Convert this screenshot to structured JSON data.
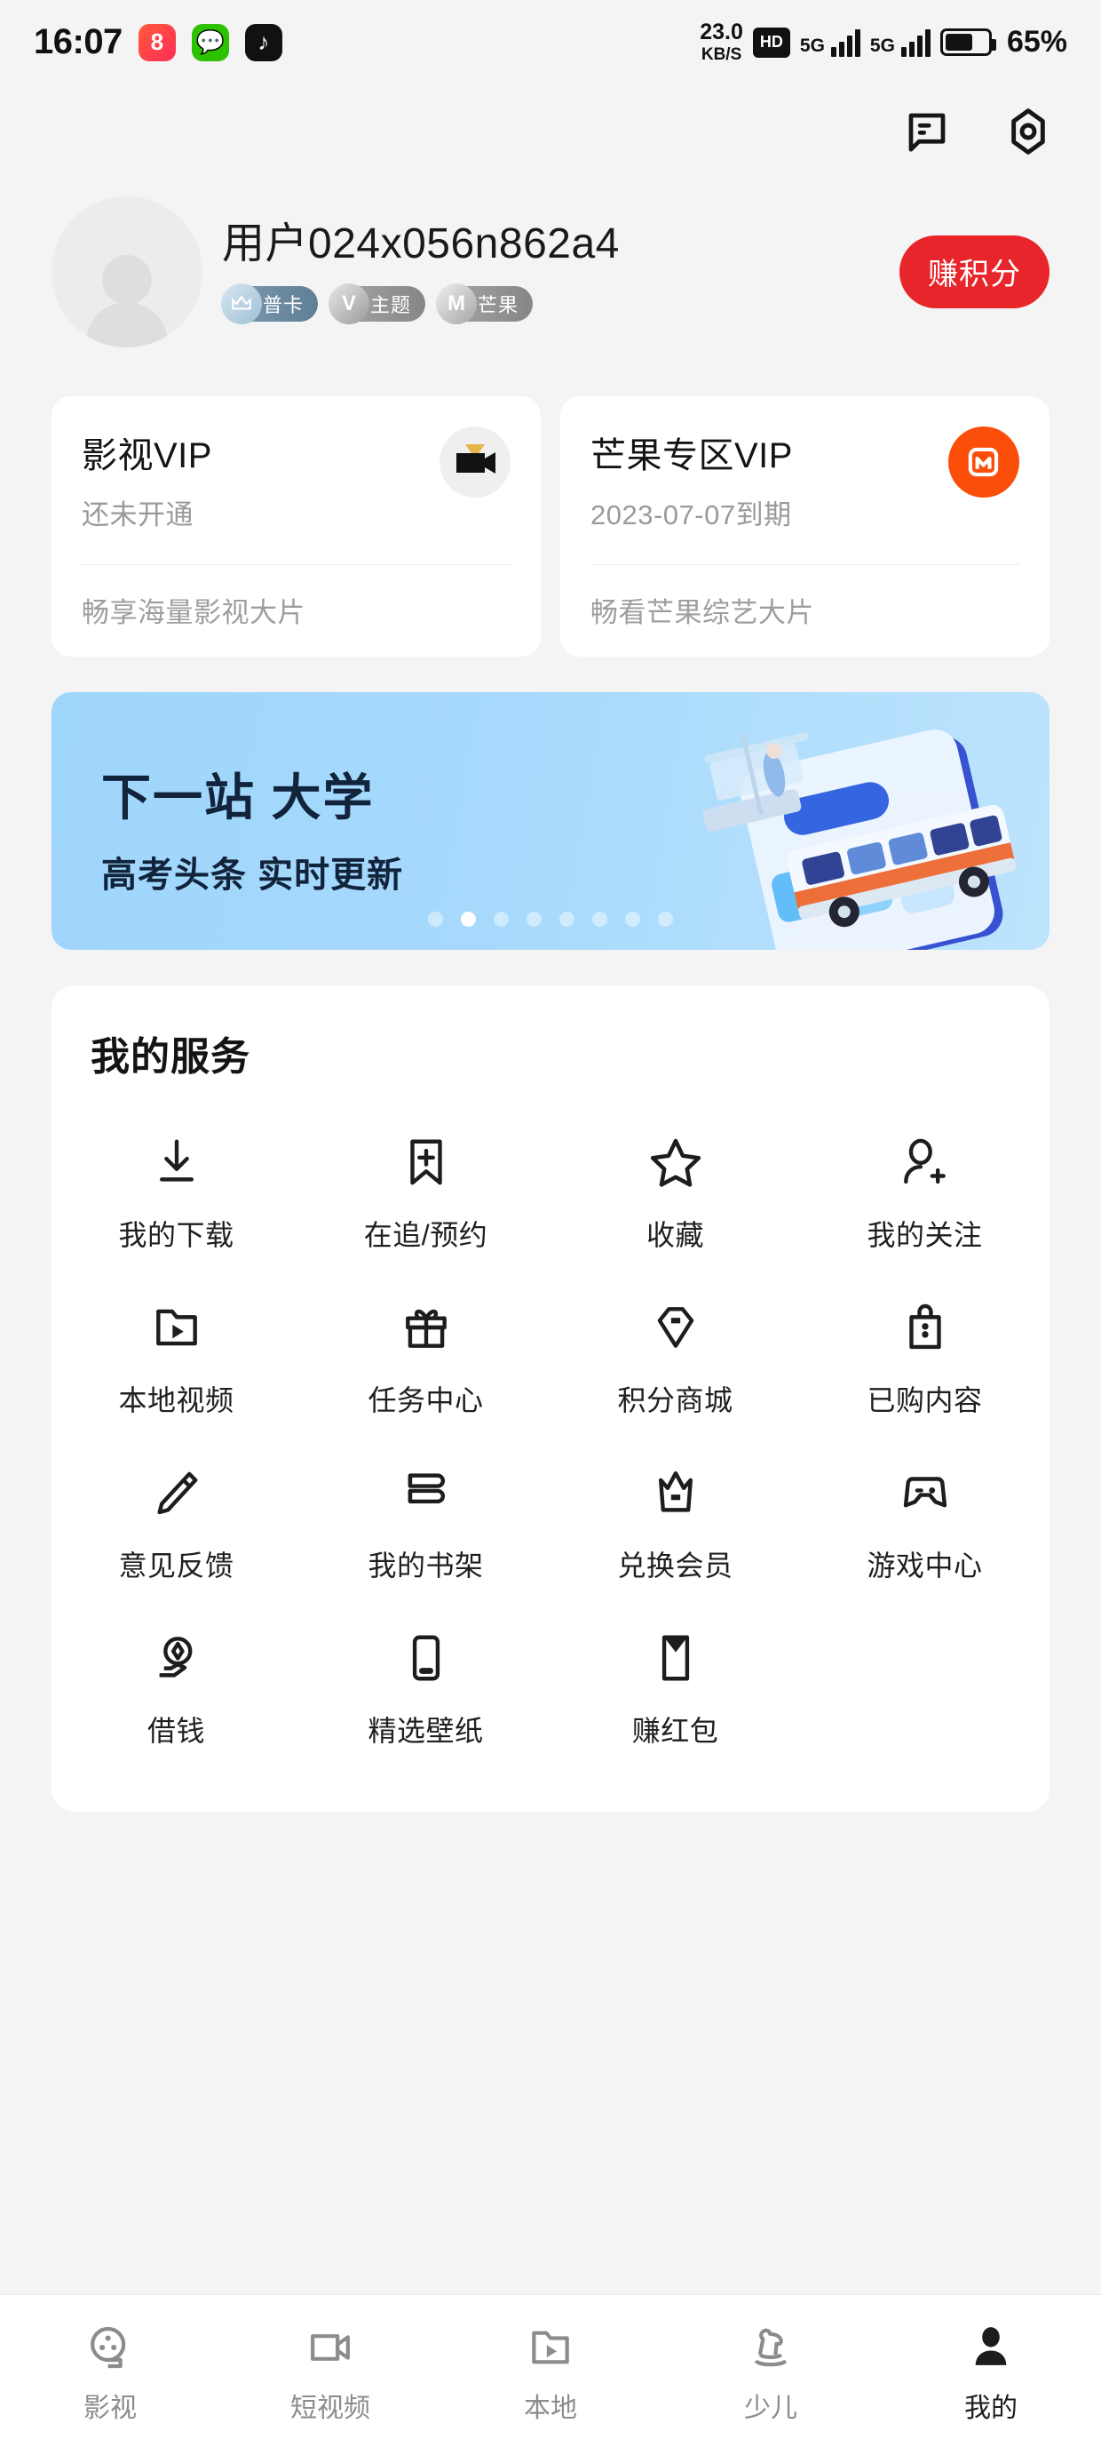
{
  "status_bar": {
    "time": "16:07",
    "apps": [
      "kuaishou-icon",
      "wechat-icon",
      "douyin-icon"
    ],
    "net_speed_value": "23.0",
    "net_speed_unit": "KB/S",
    "hd_label": "HD",
    "sim1_label": "5G",
    "sim2_label": "5G",
    "battery_percent": "65%"
  },
  "header": {
    "message_icon": "message-icon",
    "settings_icon": "settings-icon"
  },
  "profile": {
    "username": "用户024x056n862a4",
    "avatar": "default-avatar",
    "badges": [
      {
        "label": "普卡",
        "icon": "crown-badge-icon"
      },
      {
        "label": "主题",
        "icon": "theme-badge-icon"
      },
      {
        "label": "芒果",
        "icon": "mango-badge-icon"
      }
    ],
    "earn_points_button": "赚积分",
    "accent_color": "#e8252a"
  },
  "vip_cards": [
    {
      "title": "影视VIP",
      "status": "还未开通",
      "footer": "畅享海量影视大片",
      "logo": "video-vip-icon"
    },
    {
      "title": "芒果专区VIP",
      "status": "2023-07-07到期",
      "footer": "畅看芒果综艺大片",
      "logo": "mango-tv-icon",
      "logo_color": "#fb4e0a"
    }
  ],
  "banner": {
    "headline": "下一站 大学",
    "subline": "高考头条 实时更新",
    "dots_total": 8,
    "dots_active_index": 1,
    "art": "school-bus-illustration",
    "bg_color": "#a6d9fc"
  },
  "services": {
    "title": "我的服务",
    "items": [
      {
        "label": "我的下载",
        "icon": "download-icon"
      },
      {
        "label": "在追/预约",
        "icon": "bookmark-plus-icon"
      },
      {
        "label": "收藏",
        "icon": "star-icon"
      },
      {
        "label": "我的关注",
        "icon": "person-plus-icon"
      },
      {
        "label": "本地视频",
        "icon": "folder-play-icon"
      },
      {
        "label": "任务中心",
        "icon": "gift-icon"
      },
      {
        "label": "积分商城",
        "icon": "tag-icon"
      },
      {
        "label": "已购内容",
        "icon": "shopping-bag-icon"
      },
      {
        "label": "意见反馈",
        "icon": "pencil-icon"
      },
      {
        "label": "我的书架",
        "icon": "bookshelf-icon"
      },
      {
        "label": "兑换会员",
        "icon": "crown-icon"
      },
      {
        "label": "游戏中心",
        "icon": "gamepad-icon"
      },
      {
        "label": "借钱",
        "icon": "hand-coin-icon"
      },
      {
        "label": "精选壁纸",
        "icon": "phone-icon"
      },
      {
        "label": "赚红包",
        "icon": "envelope-icon"
      }
    ]
  },
  "tabbar": {
    "items": [
      {
        "label": "影视",
        "icon": "film-reel-icon",
        "active": false
      },
      {
        "label": "短视频",
        "icon": "video-camera-icon",
        "active": false
      },
      {
        "label": "本地",
        "icon": "folder-play-icon",
        "active": false
      },
      {
        "label": "少儿",
        "icon": "rocking-horse-icon",
        "active": false
      },
      {
        "label": "我的",
        "icon": "person-icon",
        "active": true
      }
    ]
  }
}
